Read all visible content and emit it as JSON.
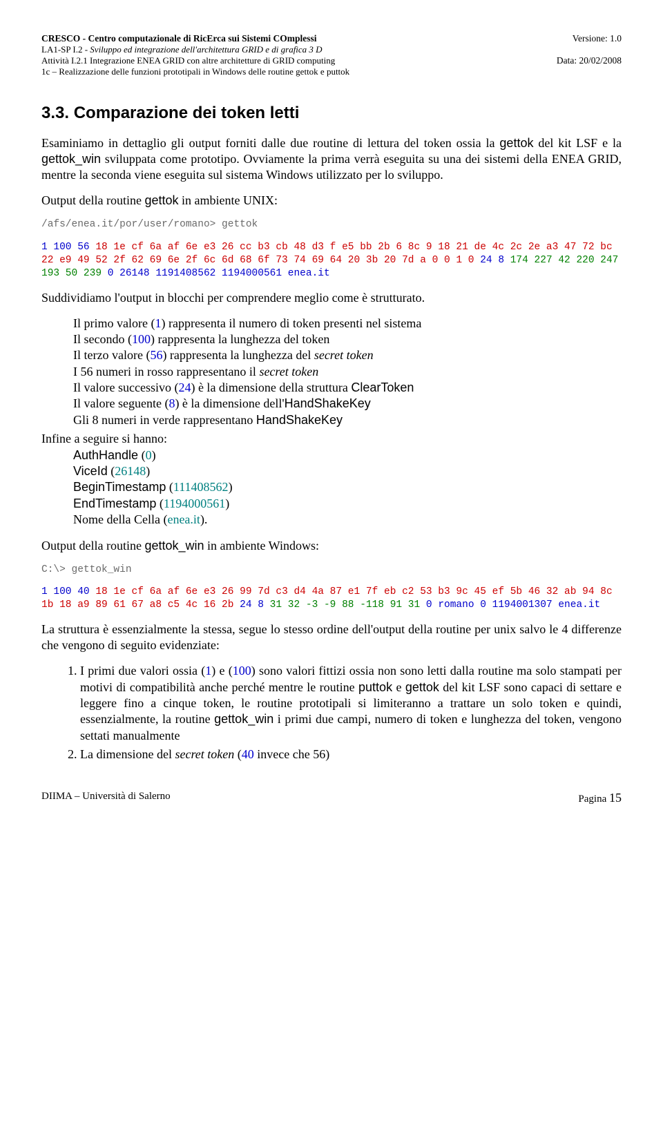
{
  "header": {
    "left": {
      "l1": "CRESCO - Centro computazionale di RicErca sui Sistemi COmplessi",
      "l2_a": "LA1-SP I.2 - ",
      "l2_b": "Sviluppo ed integrazione dell'architettura GRID e di grafica 3 D",
      "l3": "Attività I.2.1 Integrazione ENEA GRID con altre architetture di GRID computing",
      "l4": "1c – Realizzazione delle funzioni prototipali in Windows delle routine gettok e puttok"
    },
    "right": {
      "l1": "Versione: 1.0",
      "l3": "Data: 20/02/2008"
    }
  },
  "section_title": "3.3. Comparazione dei token letti",
  "p1_a": "Esaminiamo in dettaglio gli output forniti dalle due routine di lettura del token ossia la ",
  "p1_b": "gettok",
  "p1_c": " del kit LSF e la ",
  "p1_d": "gettok_win",
  "p1_e": " sviluppata come prototipo. Ovviamente la prima verrà eseguita su una dei sistemi della ENEA GRID, mentre la seconda viene eseguita sul sistema Windows utilizzato per lo sviluppo.",
  "p2_a": "Output della routine ",
  "p2_b": "gettok",
  "p2_c": " in ambiente UNIX:",
  "cmd1": "/afs/enea.it/por/user/romano> gettok",
  "out1_pre1": "1 100 56 ",
  "out1_red": "18 1e cf 6a af 6e e3 26 cc b3 cb 48 d3 f e5 bb 2b 6 8c 9 18 21 de 4c 2c 2e a3 47 72 bc 22 e9 49 52 2f 62 69 6e 2f 6c 6d 68 6f 73 74 69 64 20 3b 20 7d a 0 0 1 0",
  "out1_mid": " 24 8 ",
  "out1_green": "174 227 42 220 247 193 50 239",
  "out1_post": " 0 26148 1191408562 1194000561 enea.it",
  "p3": "Suddividiamo l'output in blocchi per comprendere meglio come è strutturato.",
  "li1_a": "Il primo valore (",
  "li1_b": "1",
  "li1_c": ") rappresenta il numero di token presenti nel sistema",
  "li2_a": "Il secondo (",
  "li2_b": "100",
  "li2_c": ") rappresenta la lunghezza del token",
  "li3_a": "Il terzo valore (",
  "li3_b": "56",
  "li3_c": ") rappresenta la lunghezza del ",
  "li3_d": "secret token",
  "li4_a": "I 56 numeri in rosso rappresentano il ",
  "li4_b": "secret token",
  "li5_a": "Il valore successivo (",
  "li5_b": "24",
  "li5_c": ") è la dimensione della struttura ",
  "li5_d": "ClearToken",
  "li6_a": "Il valore seguente (",
  "li6_b": "8",
  "li6_c": ") è la dimensione dell'",
  "li6_d": "HandShakeKey",
  "li7_a": "Gli 8 numeri in verde rappresentano ",
  "li7_b": "HandShakeKey",
  "infine": "Infine a seguire si hanno:",
  "li8_a": "AuthHandle",
  "li8_b": " (",
  "li8_c": "0",
  "li8_d": ")",
  "li9_a": "ViceId",
  "li9_b": " (",
  "li9_c": "26148",
  "li9_d": ")",
  "li10_a": "BeginTimestamp",
  "li10_b": " (",
  "li10_c": "111408562",
  "li10_d": ")",
  "li11_a": "EndTimestamp",
  "li11_b": " (",
  "li11_c": "1194000561",
  "li11_d": ")",
  "li12_a": "Nome della Cella (",
  "li12_b": "enea.it",
  "li12_c": ").",
  "p4_a": "Output della routine ",
  "p4_b": "gettok_win",
  "p4_c": " in ambiente Windows:",
  "cmd2": "C:\\> gettok_win",
  "out2_pre1": "1 100 40 ",
  "out2_red": "18 1e cf 6a af 6e e3 26 99 7d c3 d4 4a 87 e1 7f eb c2 53 b3 9c 45 ef 5b 46 32 ab 94 8c 1b 18 a9 89 61 67 a8 c5 4c 16 2b",
  "out2_mid": " 24 8 ",
  "out2_green": "31 32 -3 -9 88 -118 91 31",
  "out2_post1": " 0 romano 0 1194001307 enea.it",
  "p5": "La struttura è essenzialmente la stessa, segue lo stesso ordine dell'output della routine per unix salvo le 4 differenze che vengono di seguito evidenziate:",
  "o1_a": "I primi due valori ossia (",
  "o1_b": "1",
  "o1_c": ") e (",
  "o1_d": "100",
  "o1_e": ") sono valori fittizi ossia non sono letti dalla routine ma solo stampati per motivi di compatibilità anche perché mentre le routine ",
  "o1_f": "puttok",
  "o1_g": " e ",
  "o1_h": "gettok",
  "o1_i": " del kit LSF sono capaci di settare e leggere fino a cinque token, le routine prototipali si limiteranno a trattare un solo token e quindi, essenzialmente, la routine ",
  "o1_j": "gettok_win",
  "o1_k": " i primi due campi, numero di token e lunghezza del token, vengono settati manualmente",
  "o2_a": "La dimensione del ",
  "o2_b": "secret token",
  "o2_c": " (",
  "o2_d": "40",
  "o2_e": " invece che 56)",
  "footer": {
    "left": "DIIMA – Università di Salerno",
    "right_label": "Pagina",
    "right_num": "15"
  }
}
